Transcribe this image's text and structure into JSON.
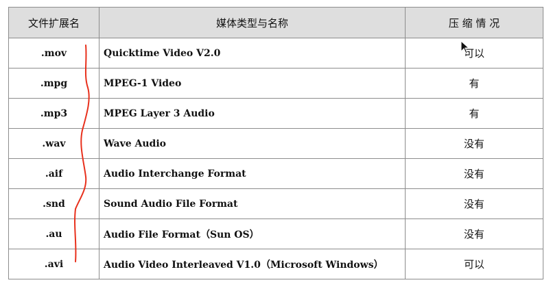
{
  "table": {
    "headers": [
      "文件扩展名",
      "媒体类型与名称",
      "压 缩 情 况"
    ],
    "rows": [
      {
        "ext": ".mov",
        "name": "Quicktime Video V2.0",
        "compression": "可以"
      },
      {
        "ext": ".mpg",
        "name": "MPEG-1 Video",
        "compression": "有"
      },
      {
        "ext": ".mp3",
        "name": "MPEG Layer 3 Audio",
        "compression": "有"
      },
      {
        "ext": ".wav",
        "name": "Wave Audio",
        "compression": "没有"
      },
      {
        "ext": ".aif",
        "name": "Audio Interchange Format",
        "compression": "没有"
      },
      {
        "ext": ".snd",
        "name": "Sound Audio File Format",
        "compression": "没有"
      },
      {
        "ext": ".au",
        "name": "Audio File Format（Sun OS）",
        "compression": "没有"
      },
      {
        "ext": ".avi",
        "name": "Audio Video Interleaved V1.0（Microsoft Windows）",
        "compression": "可以"
      }
    ]
  },
  "colors": {
    "header_bg": "#dedede",
    "border": "#8c8c8c",
    "annotation": "#e8301c"
  },
  "icons": [
    "mouse-cursor-icon"
  ]
}
